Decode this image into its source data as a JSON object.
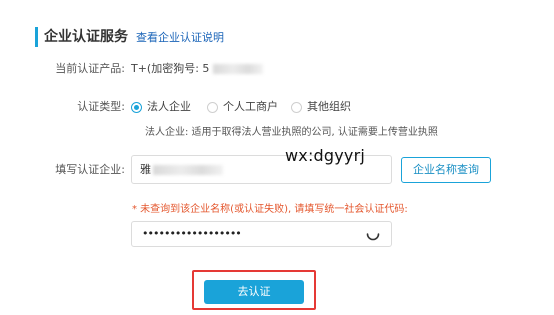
{
  "section": {
    "title": "企业认证服务",
    "doc_link": "查看企业认证说明"
  },
  "product": {
    "label": "当前认证产品:",
    "value": "T+(加密狗号: 5"
  },
  "cert_type": {
    "label": "认证类型:",
    "options": [
      {
        "label": "法人企业",
        "selected": true
      },
      {
        "label": "个人工商户",
        "selected": false
      },
      {
        "label": "其他组织",
        "selected": false
      }
    ],
    "hint": "法人企业: 适用于取得法人营业执照的公司, 认证需要上传营业执照"
  },
  "company": {
    "label": "填写认证企业:",
    "value": "雅",
    "query_button": "企业名称查询"
  },
  "watermark": "wx:dgyyrj",
  "error_message": "* 未查询到该企业名称(或认证失败), 请填写统一社会认证代码:",
  "credit_code": {
    "value": "••••••••••••••••••"
  },
  "submit_button": "去认证",
  "colors": {
    "accent": "#1aa3d9",
    "link": "#1a64b8",
    "error": "#e4572e",
    "highlight": "#e53935"
  }
}
